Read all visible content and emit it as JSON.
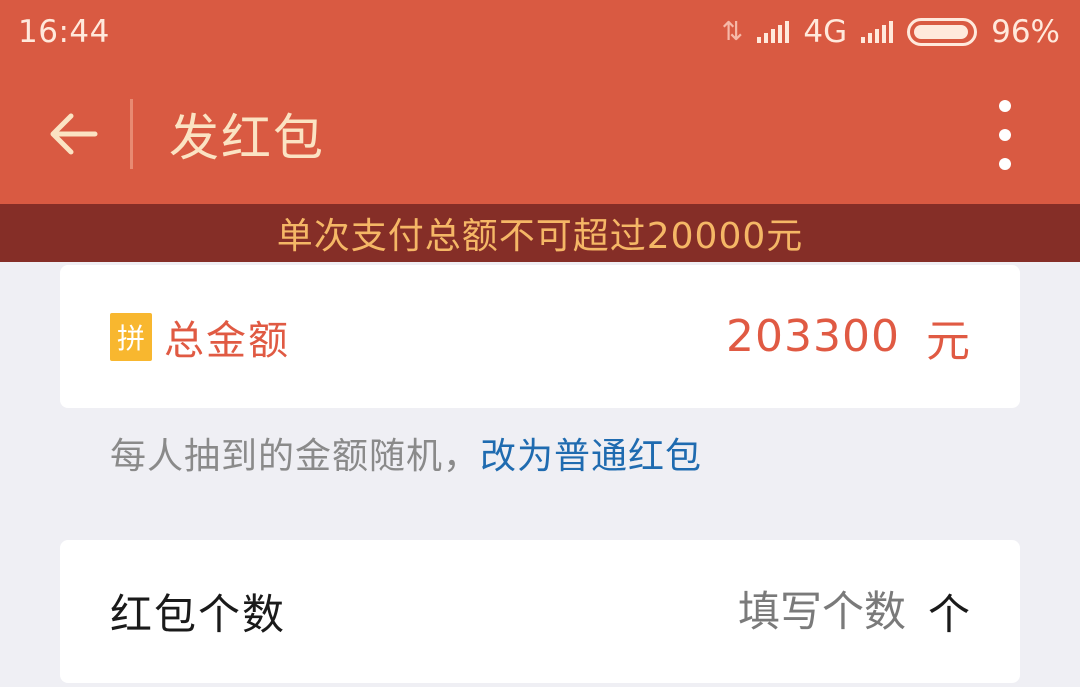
{
  "status_bar": {
    "time": "16:44",
    "network": "4G",
    "battery": "96%"
  },
  "header": {
    "title": "发红包"
  },
  "warning": {
    "text": "单次支付总额不可超过20000元"
  },
  "total": {
    "badge": "拼",
    "label": "总金额",
    "amount": "203300",
    "unit": "元"
  },
  "hint": {
    "text": "每人抽到的金额随机，",
    "link": "改为普通红包"
  },
  "count": {
    "label": "红包个数",
    "placeholder": "填写个数",
    "value": "",
    "unit": "个"
  },
  "colors": {
    "primary": "#d95a42",
    "banner": "#852e27",
    "banner_text": "#f5b766",
    "accent_red": "#e05a43",
    "link_blue": "#1f6bb0",
    "badge_yellow": "#f8b72f"
  },
  "icons": {
    "back": "arrow-left-icon",
    "more": "more-vertical-icon",
    "signal": "signal-icon",
    "battery": "battery-icon",
    "data": "data-transfer-icon"
  }
}
